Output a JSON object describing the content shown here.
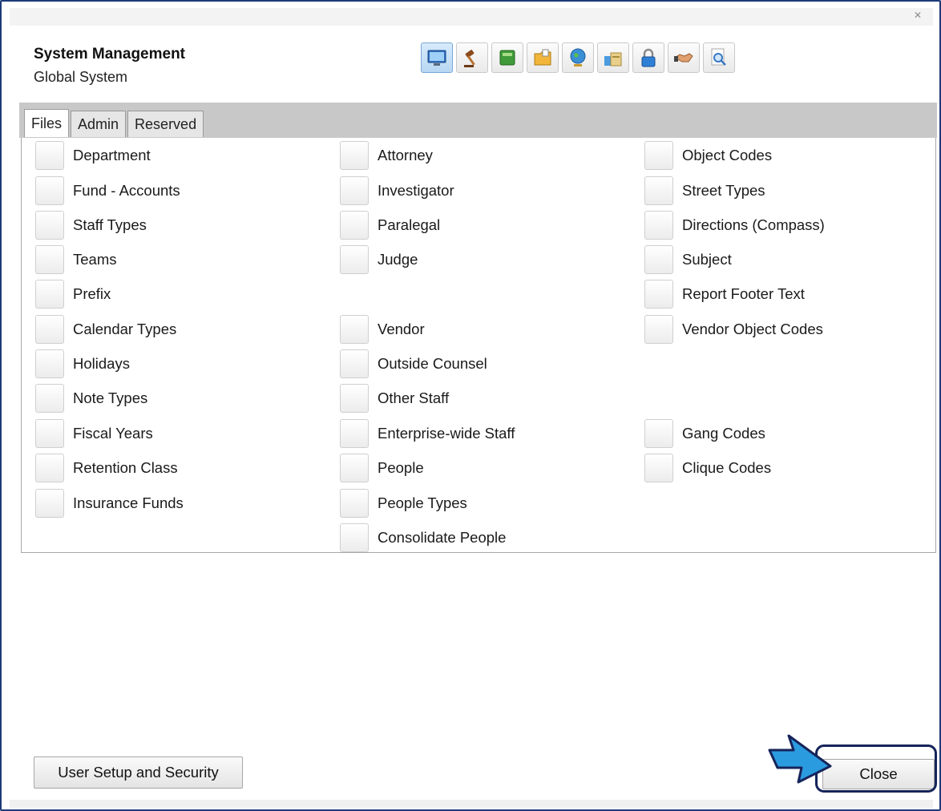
{
  "window": {
    "title": "System Management",
    "subtitle": "Global System",
    "close_icon_glyph": "✕"
  },
  "toolbar": {
    "buttons": [
      {
        "icon": "monitor-icon",
        "active": true
      },
      {
        "icon": "gavel-icon",
        "active": false
      },
      {
        "icon": "book-icon",
        "active": false
      },
      {
        "icon": "folder-icon",
        "active": false
      },
      {
        "icon": "globe-icon",
        "active": false
      },
      {
        "icon": "documents-icon",
        "active": false
      },
      {
        "icon": "lock-icon",
        "active": false
      },
      {
        "icon": "handshake-icon",
        "active": false
      },
      {
        "icon": "magnifier-icon",
        "active": false
      }
    ]
  },
  "tabs": [
    "Files",
    "Admin",
    "Reserved"
  ],
  "active_tab": "Files",
  "files": {
    "column1": [
      "Department",
      "Fund - Accounts",
      "Staff Types",
      "Teams",
      "Prefix",
      "Calendar Types",
      "Holidays",
      "Note Types",
      "Fiscal Years",
      "Retention Class",
      "Insurance Funds"
    ],
    "column2": [
      "Attorney",
      "Investigator",
      "Paralegal",
      "Judge",
      "Vendor",
      "Outside Counsel",
      "Other Staff",
      "Enterprise-wide Staff",
      "People",
      "People Types",
      "Consolidate People"
    ],
    "column3": [
      "Object Codes",
      "Street Types",
      "Directions (Compass)",
      "Subject",
      "Report Footer Text",
      "Vendor Object Codes",
      "Gang Codes",
      "Clique Codes"
    ]
  },
  "buttons": {
    "user_setup": "User Setup and Security",
    "close": "Close"
  },
  "colors": {
    "frame_border": "#1e3a78",
    "highlight_border": "#16245a",
    "arrow_fill": "#2b9be0"
  }
}
